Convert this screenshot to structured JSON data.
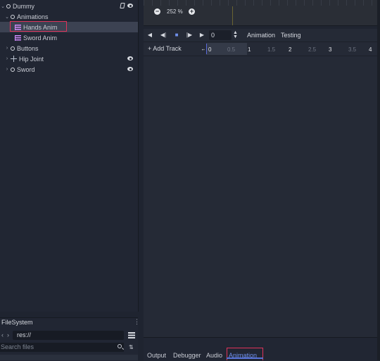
{
  "scene_tree": {
    "nodes": [
      {
        "label": "Dummy",
        "expanded": true,
        "icon": "circle-node-icon"
      },
      {
        "label": "Animations",
        "expanded": true,
        "icon": "circle-node-icon"
      },
      {
        "label": "Hands Anim",
        "icon": "animation-player-icon",
        "selected": true
      },
      {
        "label": "Sword Anim",
        "icon": "animation-player-icon"
      },
      {
        "label": "Buttons",
        "expanded": false,
        "icon": "circle-node-icon"
      },
      {
        "label": "Hip Joint",
        "expanded": false,
        "icon": "joint-icon"
      },
      {
        "label": "Sword",
        "expanded": false,
        "icon": "circle-node-icon"
      }
    ]
  },
  "filesystem": {
    "title": "FileSystem",
    "path": "res://",
    "search_placeholder": "Search files"
  },
  "viewport": {
    "zoom": "252 %",
    "zoom_out_icon": "minus-circle-icon",
    "zoom_in_icon": "plus-circle-icon"
  },
  "animation_editor": {
    "time_value": "0",
    "animation_label": "Animation",
    "selected_animation": "Testing",
    "add_track_label": "Add Track",
    "timeline_ticks": [
      "0",
      "0.5",
      "1",
      "1.5",
      "2",
      "2.5",
      "3",
      "3.5",
      "4"
    ]
  },
  "bottom_tabs": {
    "output": "Output",
    "debugger": "Debugger",
    "audio": "Audio",
    "animation": "Animation",
    "active": "Animation"
  },
  "colors": {
    "accent": "#5873d8",
    "highlight_box": "#e0335a",
    "animation_icon": "#d38cff"
  }
}
